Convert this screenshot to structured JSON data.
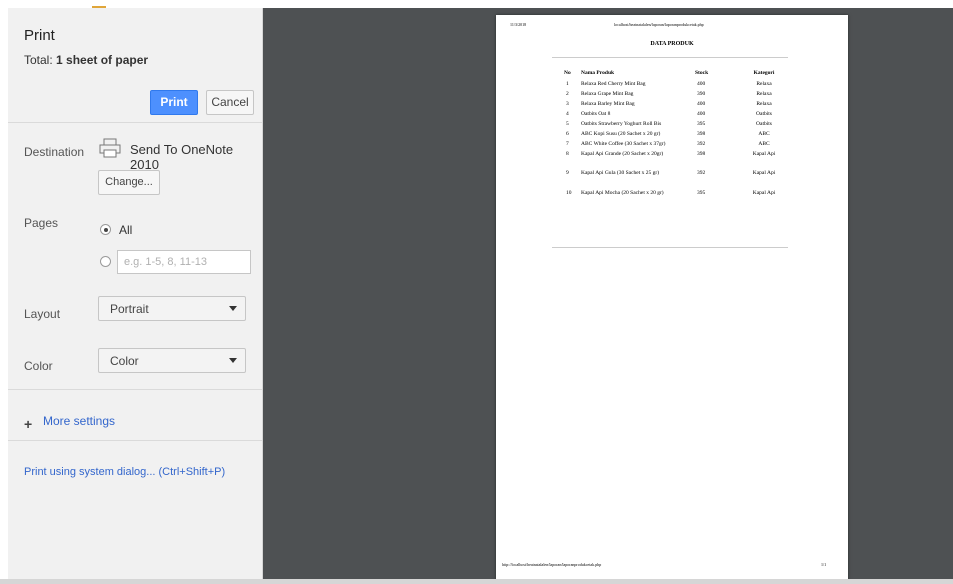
{
  "sidebar": {
    "title": "Print",
    "total_prefix": "Total: ",
    "total_value": "1 sheet of paper",
    "print_label": "Print",
    "cancel_label": "Cancel",
    "destination_label": "Destination",
    "destination_value": "Send To OneNote 2010",
    "printer_icon": "printer-icon",
    "change_label": "Change...",
    "pages_label": "Pages",
    "pages_all": "All",
    "pages_placeholder": "e.g. 1-5, 8, 11-13",
    "layout_label": "Layout",
    "layout_value": "Portrait",
    "color_label": "Color",
    "color_value": "Color",
    "more_settings": "More settings",
    "system_dialog": "Print using system dialog... (Ctrl+Shift+P)"
  },
  "preview": {
    "header_date": "11/3/2018",
    "header_url": "localhost/heatnatalalen/laporan/laporanprodukcetak.php",
    "doc_title": "DATA PRODUK",
    "columns": [
      "No",
      "Nama Produk",
      "Stock",
      "Kategori"
    ],
    "rows": [
      {
        "no": "1",
        "name": "Relaxa Red Cherry Mint Bag",
        "stock": "400",
        "cat": "Relaxa"
      },
      {
        "no": "2",
        "name": "Relaxa Grape Mint Bag",
        "stock": "390",
        "cat": "Relaxa"
      },
      {
        "no": "3",
        "name": "Relaxa Barley Mint Bag",
        "stock": "400",
        "cat": "Relaxa"
      },
      {
        "no": "4",
        "name": "Oatbits Oat 8",
        "stock": "400",
        "cat": "Oatbits"
      },
      {
        "no": "5",
        "name": "Oatbits Strawberry Yoghurt Roll Bis",
        "stock": "395",
        "cat": "Oatbits"
      },
      {
        "no": "6",
        "name": "ABC Kopi Susu (20 Sachet x 20 gr)",
        "stock": "398",
        "cat": "ABC"
      },
      {
        "no": "7",
        "name": "ABC White Coffee (30 Sachet x 37gr)",
        "stock": "392",
        "cat": "ABC"
      },
      {
        "no": "8",
        "name": "Kapal Api Grande (20 Sachet x 20gr)",
        "stock": "398",
        "cat": "Kapal Api"
      },
      {
        "no": "9",
        "name": "Kapal Api Gula (30 Sachet x 25 gr)",
        "stock": "392",
        "cat": "Kapal Api"
      },
      {
        "no": "10",
        "name": "Kapal Api Mocha (20 Sachet x 20 gr)",
        "stock": "395",
        "cat": "Kapal Api"
      }
    ],
    "footer_url": "http://localhost/heatnatalalen/laporan/laporanprodukcetak.php",
    "footer_page": "1/1"
  },
  "colors": {
    "accent": "#4d90fe",
    "link": "#3366cc",
    "preview_bg": "#4e5153",
    "sidebar_bg": "#f1f1f1"
  }
}
